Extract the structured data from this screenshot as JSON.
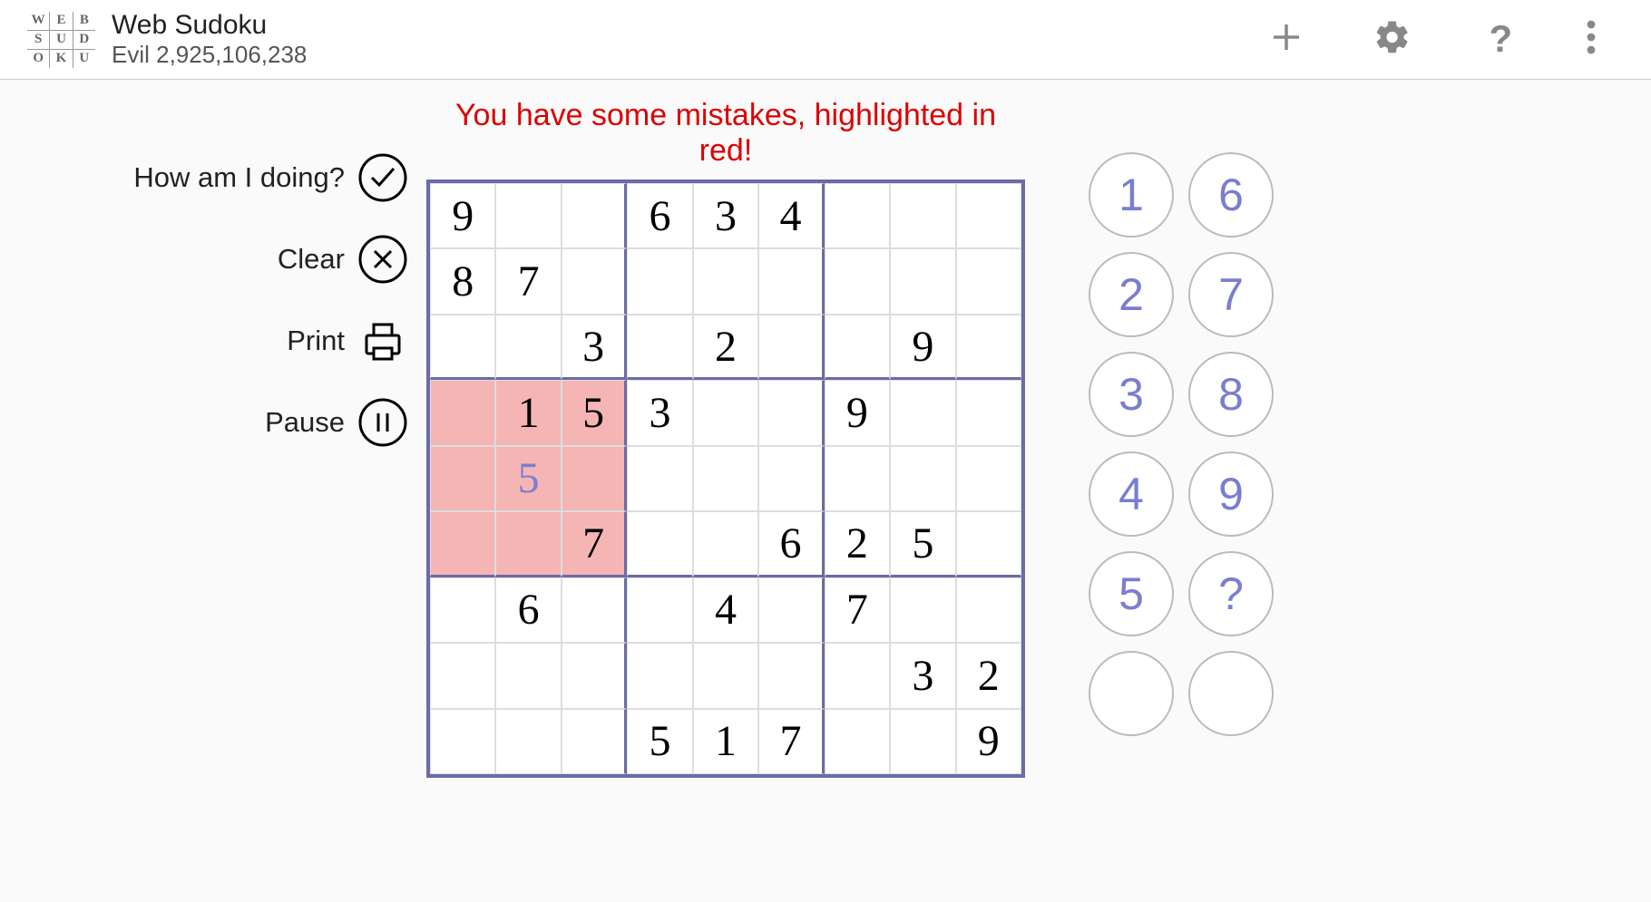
{
  "header": {
    "logo_letters": [
      "W",
      "E",
      "B",
      "S",
      "U",
      "D",
      "O",
      "K",
      "U"
    ],
    "title": "Web Sudoku",
    "subtitle": "Evil 2,925,106,238"
  },
  "controls": {
    "check_label": "How am I doing?",
    "clear_label": "Clear",
    "print_label": "Print",
    "pause_label": "Pause"
  },
  "message": "You have some mistakes, highlighted in red!",
  "board": {
    "rows": [
      [
        {
          "v": "9",
          "g": true
        },
        {
          "v": ""
        },
        {
          "v": ""
        },
        {
          "v": "6",
          "g": true
        },
        {
          "v": "3",
          "g": true
        },
        {
          "v": "4",
          "g": true
        },
        {
          "v": ""
        },
        {
          "v": ""
        },
        {
          "v": ""
        }
      ],
      [
        {
          "v": "8",
          "g": true
        },
        {
          "v": "7",
          "g": true
        },
        {
          "v": ""
        },
        {
          "v": ""
        },
        {
          "v": ""
        },
        {
          "v": ""
        },
        {
          "v": ""
        },
        {
          "v": ""
        },
        {
          "v": ""
        }
      ],
      [
        {
          "v": ""
        },
        {
          "v": ""
        },
        {
          "v": "3",
          "g": true
        },
        {
          "v": ""
        },
        {
          "v": "2",
          "g": true
        },
        {
          "v": ""
        },
        {
          "v": ""
        },
        {
          "v": "9",
          "g": true
        },
        {
          "v": ""
        }
      ],
      [
        {
          "v": "",
          "e": true
        },
        {
          "v": "1",
          "g": true,
          "e": true
        },
        {
          "v": "5",
          "g": true,
          "e": true
        },
        {
          "v": "3",
          "g": true
        },
        {
          "v": ""
        },
        {
          "v": ""
        },
        {
          "v": "9",
          "g": true
        },
        {
          "v": ""
        },
        {
          "v": ""
        }
      ],
      [
        {
          "v": "",
          "e": true
        },
        {
          "v": "5",
          "g": false,
          "e": true
        },
        {
          "v": "",
          "e": true
        },
        {
          "v": ""
        },
        {
          "v": ""
        },
        {
          "v": ""
        },
        {
          "v": ""
        },
        {
          "v": ""
        },
        {
          "v": ""
        }
      ],
      [
        {
          "v": "",
          "e": true
        },
        {
          "v": "",
          "e": true
        },
        {
          "v": "7",
          "g": true,
          "e": true
        },
        {
          "v": ""
        },
        {
          "v": ""
        },
        {
          "v": "6",
          "g": true
        },
        {
          "v": "2",
          "g": true
        },
        {
          "v": "5",
          "g": true
        },
        {
          "v": ""
        }
      ],
      [
        {
          "v": ""
        },
        {
          "v": "6",
          "g": true
        },
        {
          "v": ""
        },
        {
          "v": ""
        },
        {
          "v": "4",
          "g": true
        },
        {
          "v": ""
        },
        {
          "v": "7",
          "g": true
        },
        {
          "v": ""
        },
        {
          "v": ""
        }
      ],
      [
        {
          "v": ""
        },
        {
          "v": ""
        },
        {
          "v": ""
        },
        {
          "v": ""
        },
        {
          "v": ""
        },
        {
          "v": ""
        },
        {
          "v": ""
        },
        {
          "v": "3",
          "g": true
        },
        {
          "v": "2",
          "g": true
        }
      ],
      [
        {
          "v": ""
        },
        {
          "v": ""
        },
        {
          "v": ""
        },
        {
          "v": "5",
          "g": true
        },
        {
          "v": "1",
          "g": true
        },
        {
          "v": "7",
          "g": true
        },
        {
          "v": ""
        },
        {
          "v": ""
        },
        {
          "v": "9",
          "g": true
        }
      ]
    ]
  },
  "numpad": [
    "1",
    "6",
    "2",
    "7",
    "3",
    "8",
    "4",
    "9",
    "5",
    "?",
    "",
    ""
  ]
}
